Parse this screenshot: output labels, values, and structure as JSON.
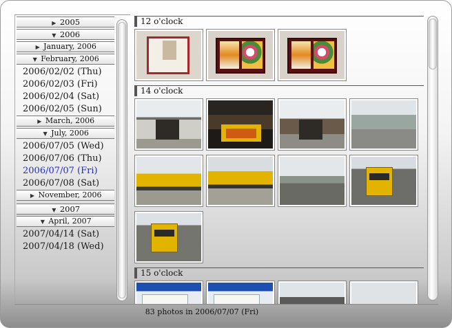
{
  "sidebar": {
    "tree": [
      {
        "kind": "hdr",
        "cls": "year",
        "tri": "▶",
        "label": "2005"
      },
      {
        "kind": "hdr",
        "cls": "year",
        "tri": "▼",
        "label": "2006"
      },
      {
        "kind": "hdr",
        "cls": "",
        "tri": "▶",
        "label": "January, 2006"
      },
      {
        "kind": "hdr",
        "cls": "",
        "tri": "▼",
        "label": "February, 2006"
      },
      {
        "kind": "day",
        "label": "2006/02/02 (Thu)"
      },
      {
        "kind": "day",
        "label": "2006/02/03 (Fri)"
      },
      {
        "kind": "day",
        "label": "2006/02/04 (Sat)"
      },
      {
        "kind": "day",
        "label": "2006/02/05 (Sun)"
      },
      {
        "kind": "hdr",
        "cls": "",
        "tri": "▶",
        "label": "March, 2006"
      },
      {
        "kind": "hdr",
        "cls": "",
        "tri": "▼",
        "label": "July, 2006"
      },
      {
        "kind": "day",
        "label": "2006/07/05 (Wed)"
      },
      {
        "kind": "day",
        "label": "2006/07/06 (Thu)"
      },
      {
        "kind": "day",
        "label": "2006/07/07 (Fri)",
        "selected": true
      },
      {
        "kind": "day",
        "label": "2006/07/08 (Sat)"
      },
      {
        "kind": "hdr",
        "cls": "",
        "tri": "▶",
        "label": "November, 2006"
      },
      {
        "kind": "hdr",
        "cls": "year gap",
        "tri": "▼",
        "label": "2007"
      },
      {
        "kind": "hdr",
        "cls": "",
        "tri": "▼",
        "label": "April, 2007"
      },
      {
        "kind": "day",
        "label": "2007/04/14 (Sat)"
      },
      {
        "kind": "day",
        "label": "2007/04/18 (Wed)"
      }
    ]
  },
  "groups": [
    {
      "label": "12 o'clock",
      "photos": [
        "bento-box-lid",
        "bento-box-open",
        "bento-box-open"
      ]
    },
    {
      "label": "14 o'clock",
      "photos": [
        "station-building",
        "kiosk-stand",
        "station-front",
        "street-view",
        "yellow-train",
        "yellow-train-side",
        "rail-tracks",
        "yellow-train-front",
        "yellow-train-platform"
      ]
    },
    {
      "label": "15 o'clock",
      "photos": [
        "ticket",
        "ticket",
        "train-tunnel",
        "cloudy-sky"
      ]
    }
  ],
  "status": {
    "text": "83 photos in 2006/07/07 (Fri)"
  },
  "colors": {
    "selected": "#1c2bd6",
    "train_yellow": "#e2b400"
  }
}
